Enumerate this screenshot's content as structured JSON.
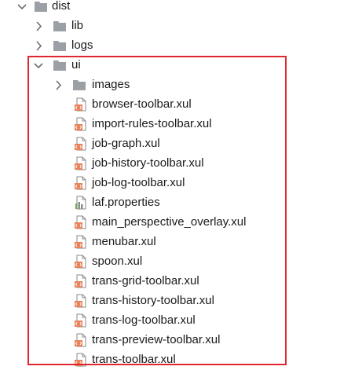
{
  "tree": {
    "dist": {
      "label": "dist",
      "expanded": true
    },
    "dist_children": [
      {
        "label": "lib",
        "expanded": false
      },
      {
        "label": "logs",
        "expanded": false
      }
    ],
    "ui": {
      "label": "ui",
      "expanded": true,
      "folders": [
        {
          "label": "images",
          "expanded": false
        }
      ],
      "files": [
        {
          "label": "browser-toolbar.xul",
          "icon": "xul-file-icon"
        },
        {
          "label": "import-rules-toolbar.xul",
          "icon": "xul-file-icon"
        },
        {
          "label": "job-graph.xul",
          "icon": "xul-file-icon"
        },
        {
          "label": "job-history-toolbar.xul",
          "icon": "xul-file-icon"
        },
        {
          "label": "job-log-toolbar.xul",
          "icon": "xul-file-icon"
        },
        {
          "label": "laf.properties",
          "icon": "properties-file-icon"
        },
        {
          "label": "main_perspective_overlay.xul",
          "icon": "xul-file-icon"
        },
        {
          "label": "menubar.xul",
          "icon": "xul-file-icon"
        },
        {
          "label": "spoon.xul",
          "icon": "xul-file-icon"
        },
        {
          "label": "trans-grid-toolbar.xul",
          "icon": "xul-file-icon"
        },
        {
          "label": "trans-history-toolbar.xul",
          "icon": "xul-file-icon"
        },
        {
          "label": "trans-log-toolbar.xul",
          "icon": "xul-file-icon"
        },
        {
          "label": "trans-preview-toolbar.xul",
          "icon": "xul-file-icon"
        },
        {
          "label": "trans-toolbar.xul",
          "icon": "xul-file-icon"
        }
      ]
    }
  },
  "colors": {
    "folder": "#9aa0a6",
    "chevron": "#6e6e6e",
    "xul_badge": "#e8825a",
    "highlight": "#e0262f"
  }
}
